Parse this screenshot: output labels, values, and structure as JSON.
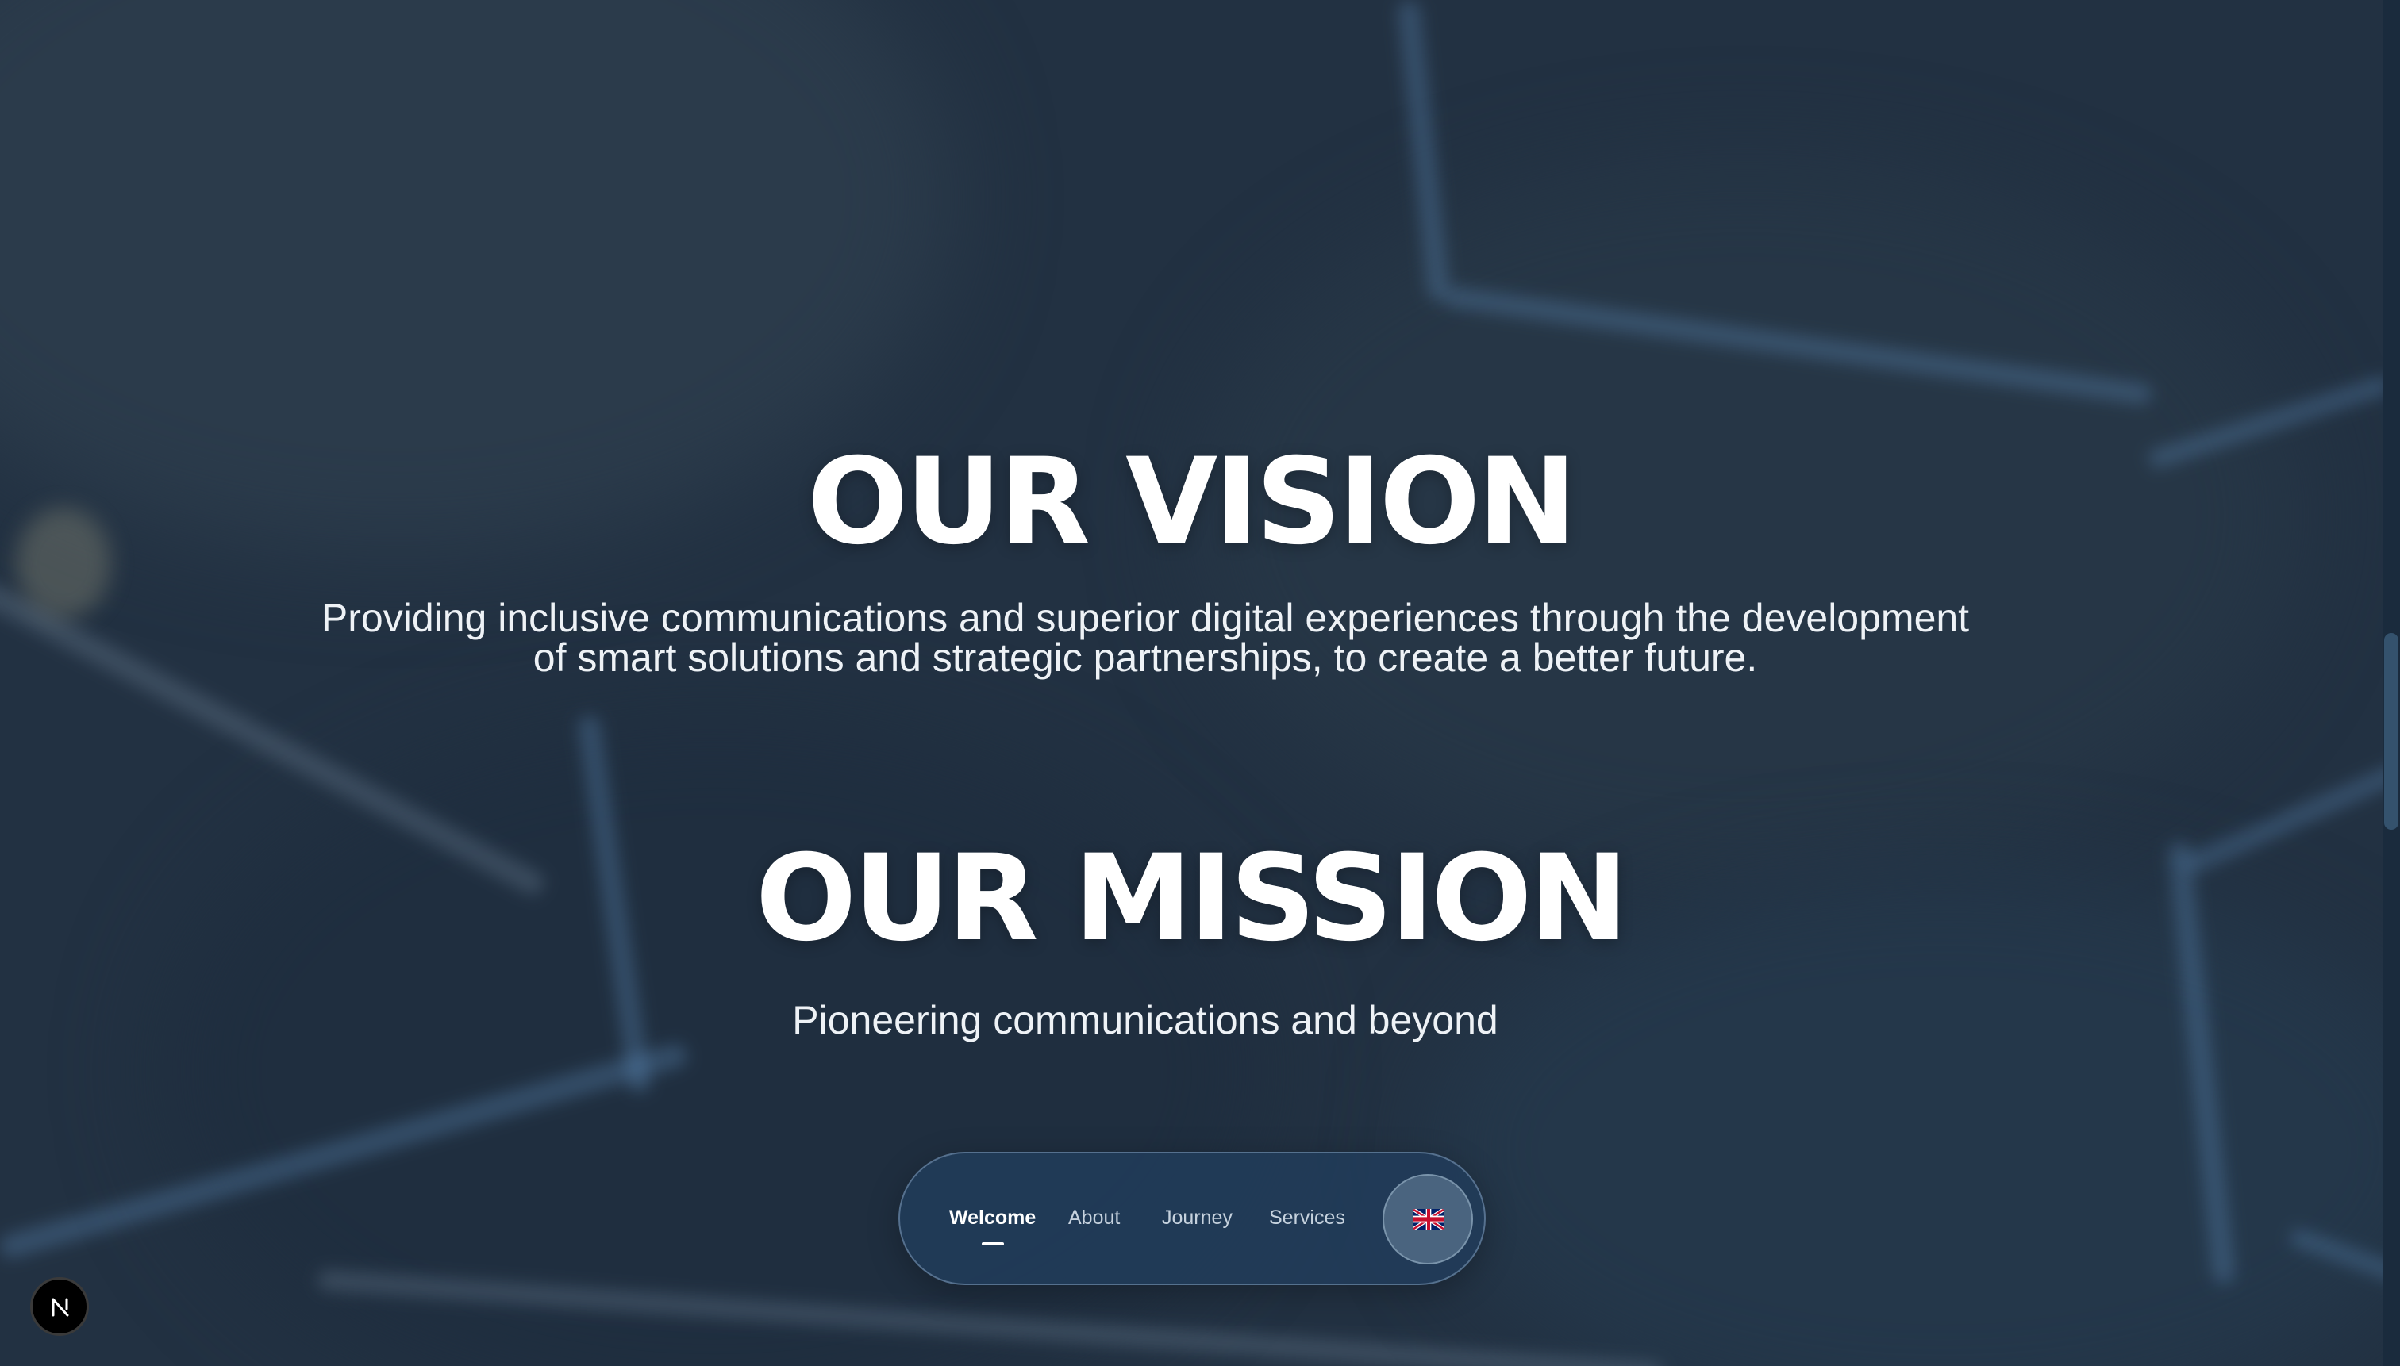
{
  "vision": {
    "title": "OUR VISION",
    "text": "Providing inclusive communications and superior digital experiences through the development of smart solutions and strategic partnerships, to create a better future."
  },
  "mission": {
    "title": "OUR MISSION",
    "text": "Pioneering communications and beyond"
  },
  "nav": {
    "items": [
      {
        "label": "Welcome",
        "active": true
      },
      {
        "label": "About",
        "active": false
      },
      {
        "label": "Journey",
        "active": false
      },
      {
        "label": "Services",
        "active": false
      }
    ],
    "language_icon": "uk-flag-icon"
  },
  "dev_badge": {
    "icon": "nextjs-logo-icon"
  },
  "colors": {
    "background": "#223142",
    "text": "#ffffff",
    "nav_background": "#213c5a"
  }
}
